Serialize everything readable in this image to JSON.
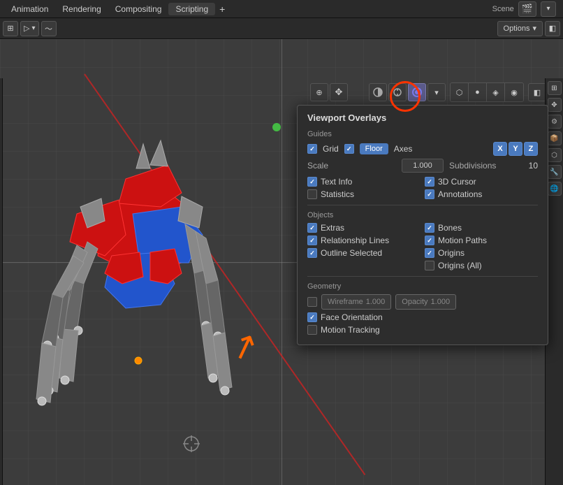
{
  "topbar": {
    "title": "Scene",
    "menu_items": [
      "Animation",
      "Rendering",
      "Compositing",
      "Scripting"
    ],
    "plus_btn": "+"
  },
  "second_toolbar": {
    "options_label": "Options",
    "options_arrow": "▾"
  },
  "overlay_popup": {
    "title": "Viewport Overlays",
    "sections": {
      "guides": {
        "label": "Guides",
        "grid_label": "Grid",
        "floor_label": "Floor",
        "axes_label": "Axes",
        "x_label": "X",
        "y_label": "Y",
        "z_label": "Z",
        "scale_label": "Scale",
        "scale_value": "1.000",
        "subdivisions_label": "Subdivisions",
        "subdivisions_value": "10",
        "text_info_label": "Text Info",
        "three_d_cursor_label": "3D Cursor",
        "statistics_label": "Statistics",
        "annotations_label": "Annotations"
      },
      "objects": {
        "label": "Objects",
        "extras_label": "Extras",
        "bones_label": "Bones",
        "relationship_lines_label": "Relationship Lines",
        "motion_paths_label": "Motion Paths",
        "outline_selected_label": "Outline Selected",
        "origins_label": "Origins",
        "origins_all_label": "Origins (All)"
      },
      "geometry": {
        "label": "Geometry",
        "wireframe_label": "Wireframe",
        "wireframe_value": "1.000",
        "opacity_label": "Opacity",
        "opacity_value": "1.000",
        "face_orientation_label": "Face Orientation",
        "motion_tracking_label": "Motion Tracking"
      }
    }
  },
  "icons": {
    "cursor": "⊕",
    "move": "✥",
    "eye": "👁",
    "globe": "🌐",
    "layers": "⊞",
    "sphere_solid": "●",
    "sphere_wire": "○",
    "material": "◈",
    "rendered": "◉",
    "scene": "🎬",
    "crosshair": "⊕"
  }
}
